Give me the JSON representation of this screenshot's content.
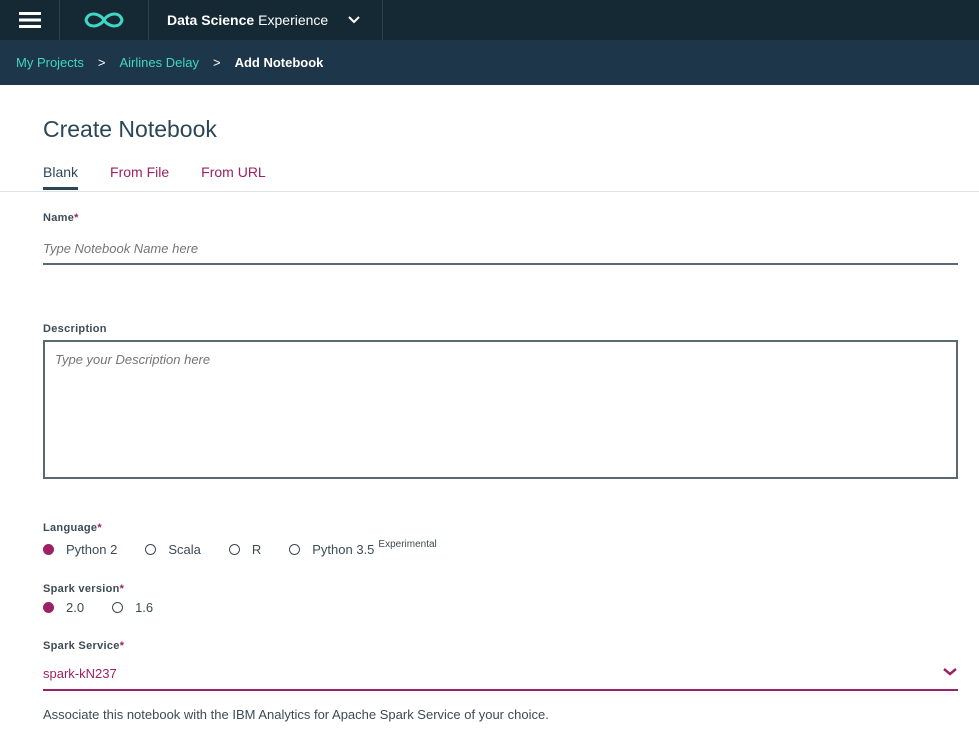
{
  "header": {
    "product_bold": "Data Science",
    "product_rest": "Experience"
  },
  "breadcrumb": {
    "items": [
      "My Projects",
      "Airlines Delay"
    ],
    "separator": ">",
    "current": "Add Notebook"
  },
  "page": {
    "title": "Create Notebook"
  },
  "tabs": [
    "Blank",
    "From File",
    "From URL"
  ],
  "form": {
    "name": {
      "label": "Name",
      "required": "*",
      "placeholder": "Type Notebook Name here"
    },
    "description": {
      "label": "Description",
      "placeholder": "Type your Description here"
    },
    "language": {
      "label": "Language",
      "required": "*",
      "options": [
        "Python 2",
        "Scala",
        "R",
        "Python 3.5"
      ],
      "experimental_tag": "Experimental",
      "selected": "Python 2"
    },
    "spark_version": {
      "label": "Spark version",
      "required": "*",
      "options": [
        "2.0",
        "1.6"
      ],
      "selected": "2.0"
    },
    "spark_service": {
      "label": "Spark Service",
      "required": "*",
      "value": "spark-kN237",
      "helper": "Associate this notebook with the IBM Analytics for Apache Spark Service of your choice."
    }
  },
  "colors": {
    "topbar": "#152935",
    "breadcrumb_bg": "#1d3649",
    "accent": "#9b2265",
    "link": "#41d6c3"
  },
  "icons": [
    "hamburger-menu-icon",
    "infinity-logo-icon",
    "chevron-down-icon"
  ]
}
